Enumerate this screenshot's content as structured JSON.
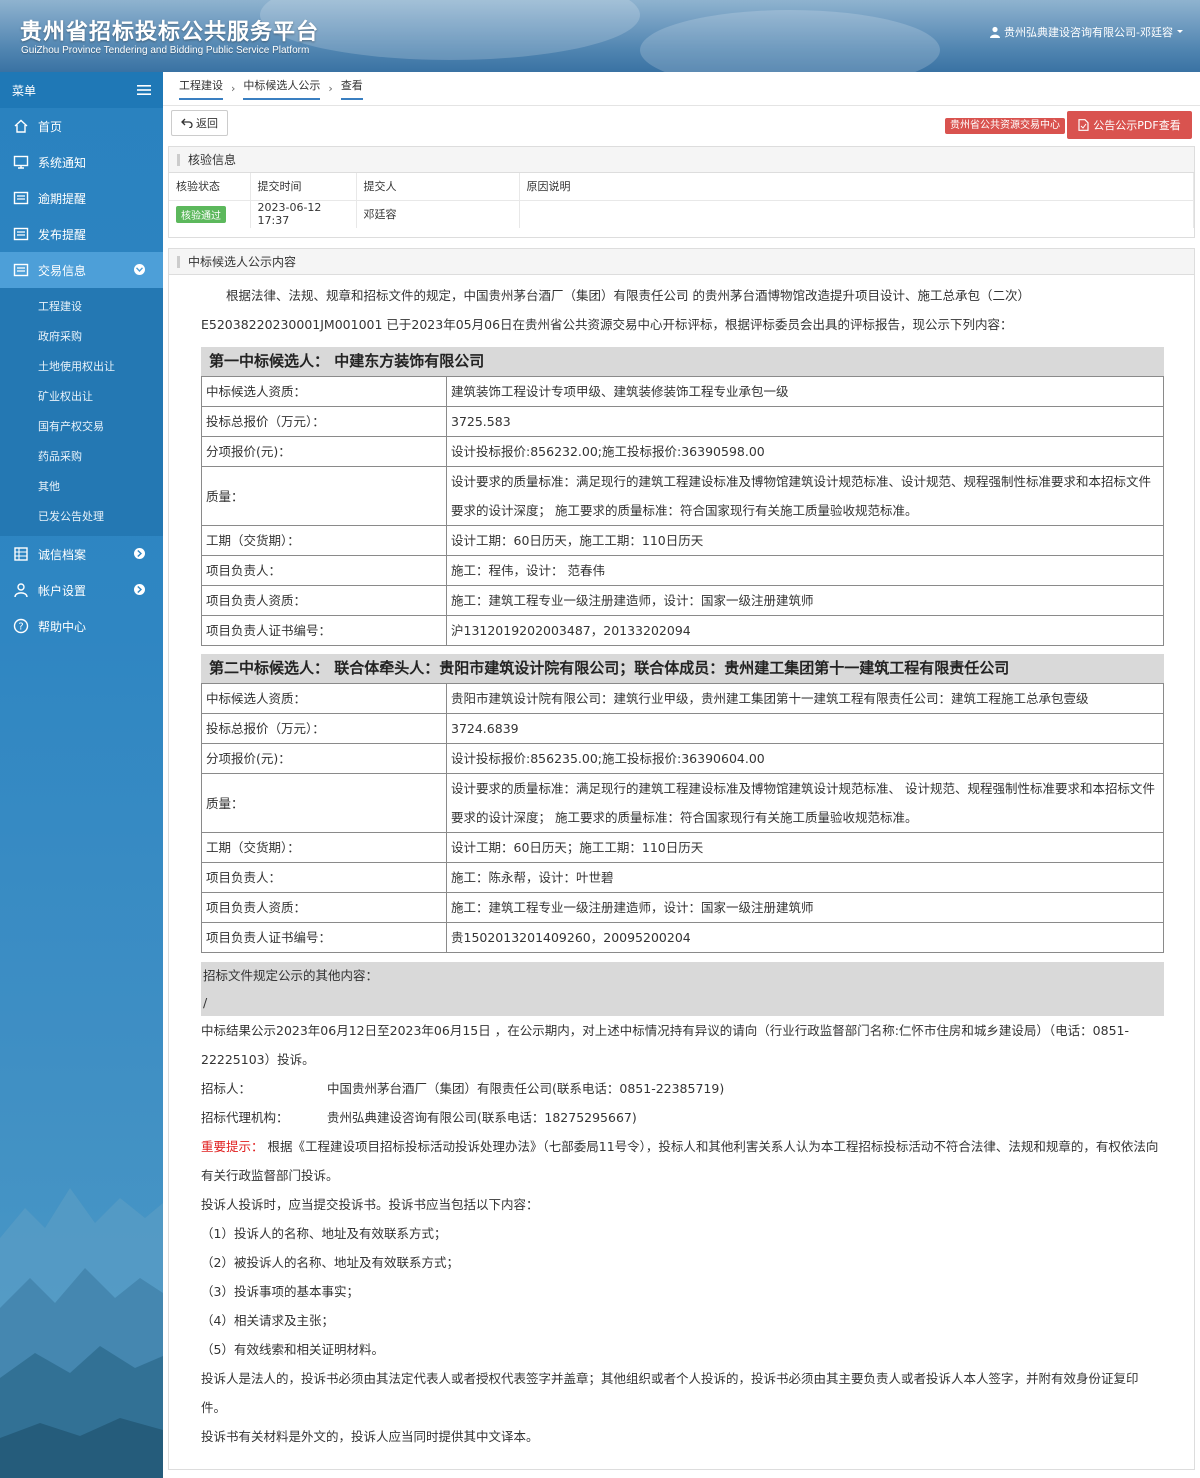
{
  "header": {
    "title": "贵州省招标投标公共服务平台",
    "subtitle": "GuiZhou Province Tendering and Bidding Public Service Platform",
    "user": "贵州弘典建设咨询有限公司-邓廷容"
  },
  "sidebar": {
    "menu_label": "菜单",
    "items": [
      {
        "label": "首页",
        "icon": "home-icon"
      },
      {
        "label": "系统通知",
        "icon": "monitor-icon"
      },
      {
        "label": "逾期提醒",
        "icon": "list-icon"
      },
      {
        "label": "发布提醒",
        "icon": "list-icon"
      },
      {
        "label": "交易信息",
        "icon": "list-icon"
      },
      {
        "label": "诚信档案",
        "icon": "grid-icon"
      },
      {
        "label": "帐户设置",
        "icon": "user-icon"
      },
      {
        "label": "帮助中心",
        "icon": "help-icon"
      }
    ],
    "submenu": [
      "工程建设",
      "政府采购",
      "土地使用权出让",
      "矿业权出让",
      "国有产权交易",
      "药品采购",
      "其他",
      "已发公告处理"
    ]
  },
  "breadcrumb": [
    "工程建设",
    "中标候选人公示",
    "查看"
  ],
  "toolbar": {
    "back_label": "返回",
    "resource_center": "贵州省公共资源交易中心",
    "pdf_label": "公告公示PDF查看"
  },
  "verify": {
    "title": "核验信息",
    "headers": [
      "核验状态",
      "提交时间",
      "提交人",
      "原因说明"
    ],
    "row": {
      "status": "核验通过",
      "time": "2023-06-12 17:37",
      "submitter": "邓廷容",
      "reason": ""
    }
  },
  "notice": {
    "title": "中标候选人公示内容",
    "intro_line1": "根据法律、法规、规章和招标文件的规定，中国贵州茅台酒厂（集团）有限责任公司 的贵州茅台酒博物馆改造提升项目设计、施工总承包（二次）",
    "intro_line2": "E52038220230001JM001001 已于2023年05月06日在贵州省公共资源交易中心开标评标，根据评标委员会出具的评标报告，现公示下列内容：",
    "candidates": [
      {
        "heading": "第一中标候选人： 中建东方装饰有限公司",
        "rows": [
          {
            "k": "中标候选人资质：",
            "v": "建筑装饰工程设计专项甲级、建筑装修装饰工程专业承包一级"
          },
          {
            "k": "投标总报价（万元）：",
            "v": "3725.583"
          },
          {
            "k": "分项报价(元)：",
            "v": "设计投标报价:856232.00;施工投标报价:36390598.00"
          },
          {
            "k": "质量：",
            "v": "设计要求的质量标准：满足现行的建筑工程建设标准及博物馆建筑设计规范标准、设计规范、规程强制性标准要求和本招标文件要求的设计深度； 施工要求的质量标准：符合国家现行有关施工质量验收规范标准。"
          },
          {
            "k": "工期（交货期）：",
            "v": "设计工期：60日历天，施工工期：110日历天"
          },
          {
            "k": "项目负责人：",
            "v": "施工：程伟，设计： 范春伟"
          },
          {
            "k": "项目负责人资质：",
            "v": "施工：建筑工程专业一级注册建造师，设计：国家一级注册建筑师"
          },
          {
            "k": "项目负责人证书编号：",
            "v": "沪1312019202003487，20133202094"
          }
        ]
      },
      {
        "heading": "第二中标候选人： 联合体牵头人：贵阳市建筑设计院有限公司；联合体成员：贵州建工集团第十一建筑工程有限责任公司",
        "rows": [
          {
            "k": "中标候选人资质：",
            "v": "贵阳市建筑设计院有限公司：建筑行业甲级，贵州建工集团第十一建筑工程有限责任公司：建筑工程施工总承包壹级"
          },
          {
            "k": "投标总报价（万元）：",
            "v": "3724.6839"
          },
          {
            "k": "分项报价(元)：",
            "v": "设计投标报价:856235.00;施工投标报价:36390604.00"
          },
          {
            "k": "质量：",
            "v": "设计要求的质量标准：满足现行的建筑工程建设标准及博物馆建筑设计规范标准、 设计规范、规程强制性标准要求和本招标文件要求的设计深度； 施工要求的质量标准：符合国家现行有关施工质量验收规范标准。"
          },
          {
            "k": "工期（交货期）：",
            "v": "设计工期：60日历天；施工工期：110日历天"
          },
          {
            "k": "项目负责人：",
            "v": "施工：陈永帮，设计：叶世碧"
          },
          {
            "k": "项目负责人资质：",
            "v": "施工：建筑工程专业一级注册建造师，设计：国家一级注册建筑师"
          },
          {
            "k": "项目负责人证书编号：",
            "v": "贵1502013201409260，20095200204"
          }
        ]
      }
    ],
    "other_label": "招标文件规定公示的其他内容：",
    "other_value": "/",
    "result_period": "中标结果公示2023年06月12日至2023年06月15日 ，在公示期内，对上述中标情况持有异议的请向（行业行政监督部门名称:仁怀市住房和城乡建设局）（电话：0851-22225103）投诉。",
    "tenderer_label": "招标人：",
    "tenderer": "中国贵州茅台酒厂（集团）有限责任公司(联系电话：0851-22385719)",
    "agency_label": "招标代理机构：",
    "agency": "贵州弘典建设咨询有限公司(联系电话：18275295667)",
    "tip_label": "重要提示：",
    "tip": " 根据《工程建设项目招标投标活动投诉处理办法》（七部委局11号令），投标人和其他利害关系人认为本工程招标投标活动不符合法律、法规和规章的，有权依法向有关行政监督部门投诉。",
    "complaint_intro": "投诉人投诉时，应当提交投诉书。投诉书应当包括以下内容：",
    "complaint_items": [
      "（1）投诉人的名称、地址及有效联系方式；",
      "（2）被投诉人的名称、地址及有效联系方式；",
      "（3）投诉事项的基本事实；",
      "（4）相关请求及主张；",
      "（5）有效线索和相关证明材料。"
    ],
    "sign_rule": "投诉人是法人的，投诉书必须由其法定代表人或者授权代表签字并盖章；其他组织或者个人投诉的，投诉书必须由其主要负责人或者投诉人本人签字，并附有效身份证复印件。",
    "foreign_rule": "投诉书有关材料是外文的，投诉人应当同时提供其中文译本。"
  }
}
